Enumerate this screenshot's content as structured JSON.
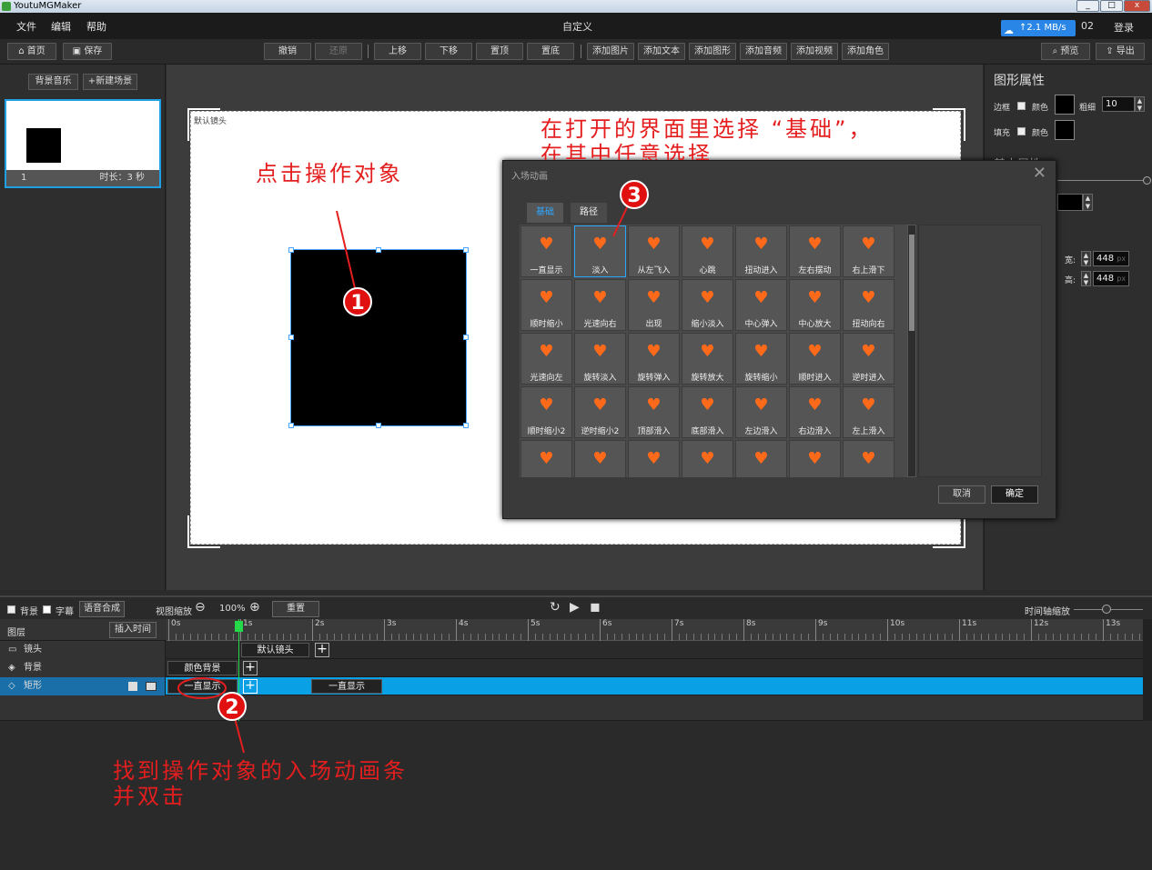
{
  "window": {
    "title": "YoutuMGMaker",
    "min": "_",
    "max": "□",
    "close": "x"
  },
  "menu": {
    "file": "文件",
    "edit": "编辑",
    "help": "帮助",
    "doc_title": "自定义",
    "speed": "↑2.1 MB/s",
    "num": "02",
    "login": "登录"
  },
  "toolbar": {
    "home": "首页",
    "save": "保存",
    "undo": "撤销",
    "redo": "还原",
    "up": "上移",
    "down": "下移",
    "top": "置顶",
    "bottom": "置底",
    "add_image": "添加图片",
    "add_text": "添加文本",
    "add_shape": "添加图形",
    "add_audio": "添加音频",
    "add_video": "添加视频",
    "add_role": "添加角色",
    "preview": "预览",
    "export": "导出"
  },
  "left": {
    "bg_music": "背景音乐",
    "new_scene": "+新建场景",
    "scene_index": "1",
    "scene_duration": "时长：3 秒"
  },
  "stage": {
    "camera_label": "默认镜头"
  },
  "annotations": {
    "note1": "点击操作对象",
    "note2_line1": "找到操作对象的入场动画条",
    "note2_line2": "并双击",
    "note3_line1": "在打开的界面里选择 “基础”，",
    "note3_line2": "在其中任意选择",
    "c1": "1",
    "c2": "2",
    "c3": "3"
  },
  "right": {
    "title": "图形属性",
    "border": "边框",
    "color": "颜色",
    "thickness": "粗细",
    "thickness_value": "10",
    "fill": "填充",
    "fill_color": "颜色",
    "basic_attr": "基本属性",
    "width_label": "宽:",
    "width_value": "448",
    "height_label": "高:",
    "height_value": "448",
    "px": "px"
  },
  "dialog": {
    "title": "入场动画",
    "tab_basic": "基础",
    "tab_path": "路径",
    "cancel": "取消",
    "ok": "确定",
    "items": [
      {
        "label": "一直显示",
        "icon": "♥"
      },
      {
        "label": "淡入",
        "icon": "♥"
      },
      {
        "label": "从左飞入",
        "icon": "♥"
      },
      {
        "label": "心跳",
        "icon": "♥"
      },
      {
        "label": "扭动进入",
        "icon": "♥"
      },
      {
        "label": "左右摆动",
        "icon": "♥"
      },
      {
        "label": "右上滑下",
        "icon": "♥"
      },
      {
        "label": "顺时缩小",
        "icon": "♥"
      },
      {
        "label": "光速向右",
        "icon": "♥"
      },
      {
        "label": "出现",
        "icon": "♥"
      },
      {
        "label": "缩小淡入",
        "icon": "♥"
      },
      {
        "label": "中心弹入",
        "icon": "♥"
      },
      {
        "label": "中心放大",
        "icon": "♥"
      },
      {
        "label": "扭动向右",
        "icon": "♥"
      },
      {
        "label": "光速向左",
        "icon": "♥"
      },
      {
        "label": "旋转淡入",
        "icon": "♥"
      },
      {
        "label": "旋转弹入",
        "icon": "♥"
      },
      {
        "label": "旋转放大",
        "icon": "♥"
      },
      {
        "label": "旋转缩小",
        "icon": "♥"
      },
      {
        "label": "顺时进入",
        "icon": "♥"
      },
      {
        "label": "逆时进入",
        "icon": "♥"
      },
      {
        "label": "顺时缩小2",
        "icon": "♥"
      },
      {
        "label": "逆时缩小2",
        "icon": "♥"
      },
      {
        "label": "顶部滑入",
        "icon": "♥"
      },
      {
        "label": "底部滑入",
        "icon": "♥"
      },
      {
        "label": "左边滑入",
        "icon": "♥"
      },
      {
        "label": "右边滑入",
        "icon": "♥"
      },
      {
        "label": "左上滑入",
        "icon": "♥"
      },
      {
        "label": "",
        "icon": "♥"
      },
      {
        "label": "",
        "icon": "♥"
      },
      {
        "label": "",
        "icon": "♥"
      },
      {
        "label": "",
        "icon": "♥"
      },
      {
        "label": "",
        "icon": "♥"
      },
      {
        "label": "",
        "icon": "♥"
      },
      {
        "label": "",
        "icon": "♥"
      }
    ],
    "selected_index": 1
  },
  "timeline": {
    "bg_check": "背景",
    "sub_check": "字幕",
    "tts": "语音合成",
    "zoom_label": "视图缩放",
    "zoom_value": "100%",
    "reset": "重置",
    "axis_zoom": "时间轴缩放",
    "layer_header": "图层",
    "insert_time": "插入时间",
    "ticks": [
      "0s",
      "1s",
      "2s",
      "3s",
      "4s",
      "5s",
      "6s",
      "7s",
      "8s",
      "9s",
      "10s",
      "11s",
      "12s",
      "13s"
    ],
    "rows": {
      "camera": "镜头",
      "background": "背景",
      "shape": "矩形"
    },
    "blocks": {
      "camera": "默认镜头",
      "background": "颜色背景",
      "enter": "一直显示",
      "stay": "一直显示"
    }
  }
}
